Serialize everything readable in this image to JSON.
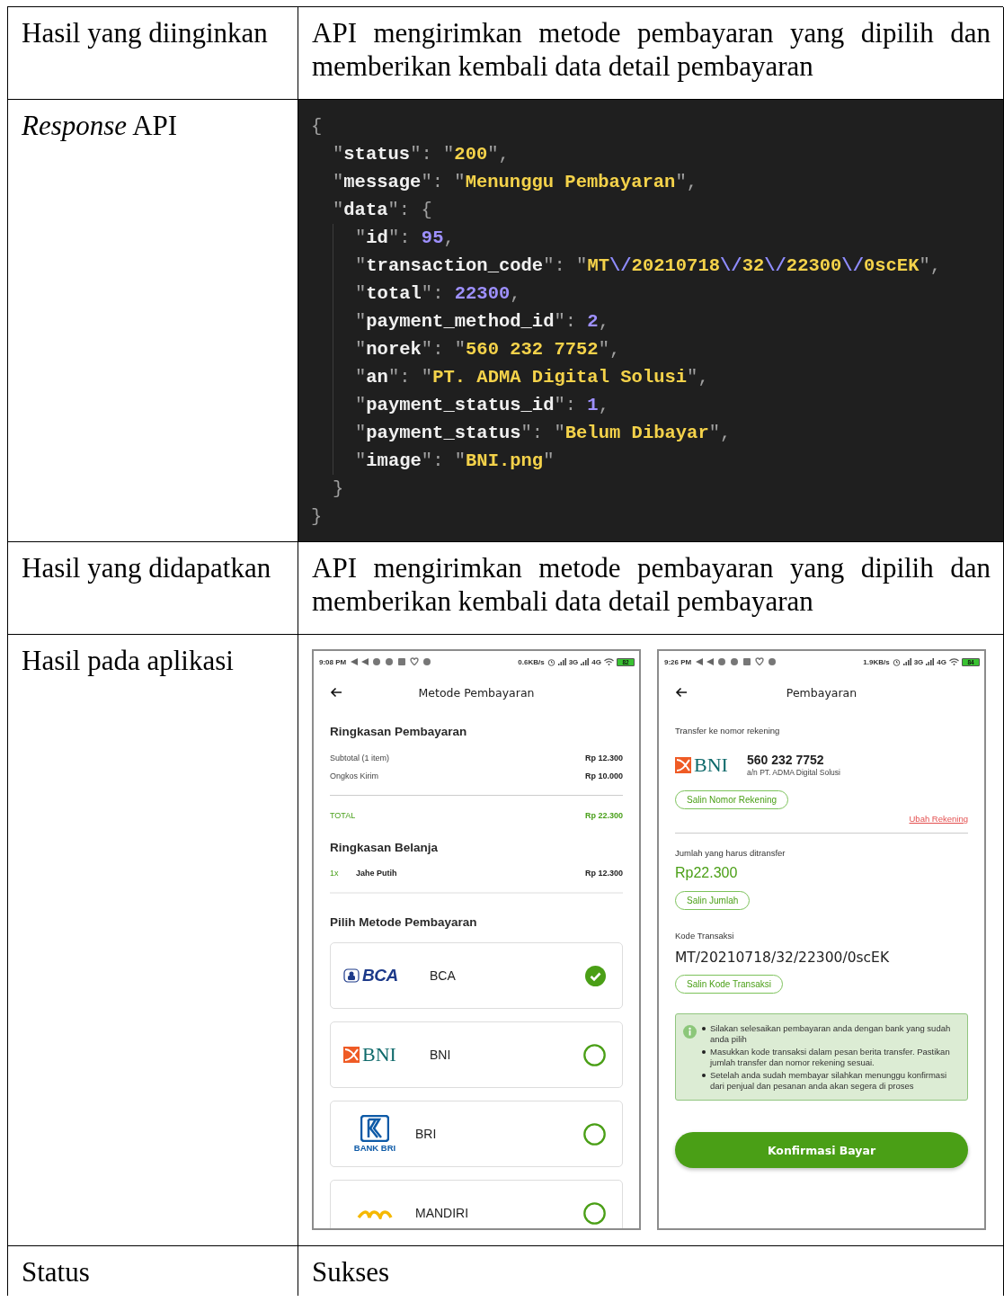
{
  "table": {
    "rows": [
      {
        "label": "Hasil yang diinginkan",
        "kind": "text",
        "text": "API mengirimkan metode pembayaran yang dipilih dan memberikan kembali data detail pembayaran"
      },
      {
        "label": "*Response* API",
        "kind": "code",
        "code": {
          "open": "{",
          "close": "}",
          "lines": [
            {
              "tokens": [
                {
                  "kind": "punct",
                  "text": "\""
                },
                {
                  "kind": "key",
                  "text": "status"
                },
                {
                  "kind": "punct",
                  "text": "\": \""
                },
                {
                  "kind": "string",
                  "text": "200"
                },
                {
                  "kind": "punct",
                  "text": "\","
                }
              ]
            },
            {
              "tokens": [
                {
                  "kind": "punct",
                  "text": "\""
                },
                {
                  "kind": "key",
                  "text": "message"
                },
                {
                  "kind": "punct",
                  "text": "\": \""
                },
                {
                  "kind": "string",
                  "text": "Menunggu Pembayaran"
                },
                {
                  "kind": "punct",
                  "text": "\","
                }
              ]
            },
            {
              "tokens": [
                {
                  "kind": "punct",
                  "text": "\""
                },
                {
                  "kind": "key",
                  "text": "data"
                },
                {
                  "kind": "punct",
                  "text": "\": {"
                }
              ],
              "close": "}",
              "lines": [
                {
                  "tokens": [
                    {
                      "kind": "punct",
                      "text": "\""
                    },
                    {
                      "kind": "key",
                      "text": "id"
                    },
                    {
                      "kind": "punct",
                      "text": "\": "
                    },
                    {
                      "kind": "number",
                      "text": "95"
                    },
                    {
                      "kind": "punct",
                      "text": ","
                    }
                  ]
                },
                {
                  "tokens": [
                    {
                      "kind": "punct",
                      "text": "\""
                    },
                    {
                      "kind": "key",
                      "text": "transaction_code"
                    },
                    {
                      "kind": "punct",
                      "text": "\": \""
                    },
                    {
                      "kind": "string",
                      "text": "MT"
                    },
                    {
                      "kind": "escape",
                      "text": "\\/"
                    },
                    {
                      "kind": "string",
                      "text": "20210718"
                    },
                    {
                      "kind": "escape",
                      "text": "\\/"
                    },
                    {
                      "kind": "string",
                      "text": "32"
                    },
                    {
                      "kind": "escape",
                      "text": "\\/"
                    },
                    {
                      "kind": "string",
                      "text": "22300"
                    },
                    {
                      "kind": "escape",
                      "text": "\\/"
                    },
                    {
                      "kind": "string",
                      "text": "0scEK"
                    },
                    {
                      "kind": "punct",
                      "text": "\","
                    }
                  ]
                },
                {
                  "tokens": [
                    {
                      "kind": "punct",
                      "text": "\""
                    },
                    {
                      "kind": "key",
                      "text": "total"
                    },
                    {
                      "kind": "punct",
                      "text": "\": "
                    },
                    {
                      "kind": "number",
                      "text": "22300"
                    },
                    {
                      "kind": "punct",
                      "text": ","
                    }
                  ]
                },
                {
                  "tokens": [
                    {
                      "kind": "punct",
                      "text": "\""
                    },
                    {
                      "kind": "key",
                      "text": "payment_method_id"
                    },
                    {
                      "kind": "punct",
                      "text": "\": "
                    },
                    {
                      "kind": "number",
                      "text": "2"
                    },
                    {
                      "kind": "punct",
                      "text": ","
                    }
                  ]
                },
                {
                  "tokens": [
                    {
                      "kind": "punct",
                      "text": "\""
                    },
                    {
                      "kind": "key",
                      "text": "norek"
                    },
                    {
                      "kind": "punct",
                      "text": "\": \""
                    },
                    {
                      "kind": "string",
                      "text": "560 232 7752"
                    },
                    {
                      "kind": "punct",
                      "text": "\","
                    }
                  ]
                },
                {
                  "tokens": [
                    {
                      "kind": "punct",
                      "text": "\""
                    },
                    {
                      "kind": "key",
                      "text": "an"
                    },
                    {
                      "kind": "punct",
                      "text": "\": \""
                    },
                    {
                      "kind": "string",
                      "text": "PT. ADMA Digital Solusi"
                    },
                    {
                      "kind": "punct",
                      "text": "\","
                    }
                  ]
                },
                {
                  "tokens": [
                    {
                      "kind": "punct",
                      "text": "\""
                    },
                    {
                      "kind": "key",
                      "text": "payment_status_id"
                    },
                    {
                      "kind": "punct",
                      "text": "\": "
                    },
                    {
                      "kind": "number",
                      "text": "1"
                    },
                    {
                      "kind": "punct",
                      "text": ","
                    }
                  ]
                },
                {
                  "tokens": [
                    {
                      "kind": "punct",
                      "text": "\""
                    },
                    {
                      "kind": "key",
                      "text": "payment_status"
                    },
                    {
                      "kind": "punct",
                      "text": "\": \""
                    },
                    {
                      "kind": "string",
                      "text": "Belum Dibayar"
                    },
                    {
                      "kind": "punct",
                      "text": "\","
                    }
                  ]
                },
                {
                  "tokens": [
                    {
                      "kind": "punct",
                      "text": "\""
                    },
                    {
                      "kind": "key",
                      "text": "image"
                    },
                    {
                      "kind": "punct",
                      "text": "\": \""
                    },
                    {
                      "kind": "string",
                      "text": "BNI.png"
                    },
                    {
                      "kind": "punct",
                      "text": "\""
                    }
                  ]
                }
              ]
            }
          ]
        }
      },
      {
        "label": "Hasil yang didapatkan",
        "kind": "text",
        "text": "API mengirimkan metode pembayaran yang dipilih dan memberikan kembali data detail pembayaran"
      },
      {
        "label": "Hasil pada aplikasi",
        "kind": "screens",
        "screens": [
          {
            "kind": "methods",
            "status_bar": {
              "time": "9:08 PM",
              "speed": "0.6KB/s",
              "networks": [
                "3G",
                "4G"
              ],
              "battery": "82"
            },
            "title": "Metode Pembayaran",
            "summary_title": "Ringkasan Pembayaran",
            "summary_rows": [
              {
                "label": "Subtotal (1 item)",
                "amount": "Rp 12.300"
              },
              {
                "label": "Ongkos Kirim",
                "amount": "Rp 10.000"
              }
            ],
            "total": {
              "label": "TOTAL",
              "amount": "Rp 22.300"
            },
            "cart_title": "Ringkasan Belanja",
            "cart_items": [
              {
                "qty": "1x",
                "name": "Jahe Putih",
                "amount": "Rp 12.300"
              }
            ],
            "methods_title": "Pilih Metode Pembayaran",
            "methods": [
              {
                "logo": {
                  "kind": "bca",
                  "text": "BCA"
                },
                "name": "BCA",
                "selected": true
              },
              {
                "logo": {
                  "kind": "bni",
                  "text": "BNI"
                },
                "name": "BNI",
                "selected": false
              },
              {
                "logo": {
                  "kind": "bri",
                  "text": "BANK BRI"
                },
                "name": "BRI",
                "selected": false
              },
              {
                "logo": {
                  "kind": "mandiri"
                },
                "name": "MANDIRI",
                "selected": false
              }
            ]
          },
          {
            "kind": "payment",
            "status_bar": {
              "time": "9:26 PM",
              "speed": "1.9KB/s",
              "networks": [
                "3G",
                "4G"
              ],
              "battery": "84"
            },
            "title": "Pembayaran",
            "transfer_label": "Transfer ke nomor rekening",
            "bank": {
              "logo": {
                "kind": "bni",
                "text": "BNI"
              },
              "account_number": "560 232 7752",
              "account_name": "a/n PT. ADMA Digital Solusi"
            },
            "copy_account_button": "Salin Nomor Rekening",
            "change_account_link": "Ubah Rekening",
            "amount_label": "Jumlah yang harus ditransfer",
            "amount": "Rp22.300",
            "copy_amount_button": "Salin Jumlah",
            "code_label": "Kode Transaksi",
            "transaction_code": "MT/20210718/32/22300/0scEK",
            "copy_code_button": "Salin Kode Transaksi",
            "instructions": [
              "Silakan selesaikan pembayaran anda dengan bank yang sudah anda pilih",
              "Masukkan kode transaksi dalam pesan berita transfer. Pastikan jumlah transfer dan nomor rekening sesuai.",
              "Setelah anda sudah membayar silahkan menunggu konfirmasi dari penjual dan pesanan anda akan segera di proses"
            ],
            "confirm_button": "Konfirmasi Bayar"
          }
        ]
      },
      {
        "label": "Status",
        "kind": "text",
        "text": "Sukses"
      }
    ]
  }
}
